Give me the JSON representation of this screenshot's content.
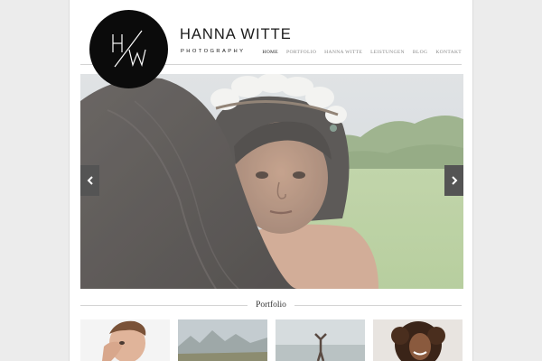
{
  "brand": {
    "name": "HANNA WITTE",
    "tagline": "PHOTOGRAPHY",
    "monogram": "H/W"
  },
  "nav": {
    "items": [
      {
        "label": "HOME",
        "active": true
      },
      {
        "label": "PORTFOLIO",
        "active": false
      },
      {
        "label": "HANNA WITTE",
        "active": false
      },
      {
        "label": "LEISTUNGEN",
        "active": false
      },
      {
        "label": "BLOG",
        "active": false
      },
      {
        "label": "KONTAKT",
        "active": false
      }
    ]
  },
  "slider": {
    "image": "portrait of a child in feathered headdress held on a shoulder, green field background",
    "prev_icon": "chevron-left-icon",
    "next_icon": "chevron-right-icon"
  },
  "portfolio": {
    "title": "Portfolio",
    "thumbnails": [
      {
        "image": "man covering face with hand"
      },
      {
        "image": "mountain landscape"
      },
      {
        "image": "person doing handstand on beach"
      },
      {
        "image": "smiling woman with curly hair"
      }
    ]
  },
  "colors": {
    "logo_bg": "#0b0b0b",
    "arrow_bg": "#545454",
    "nav_active": "#222222",
    "nav_inactive": "#888888"
  }
}
